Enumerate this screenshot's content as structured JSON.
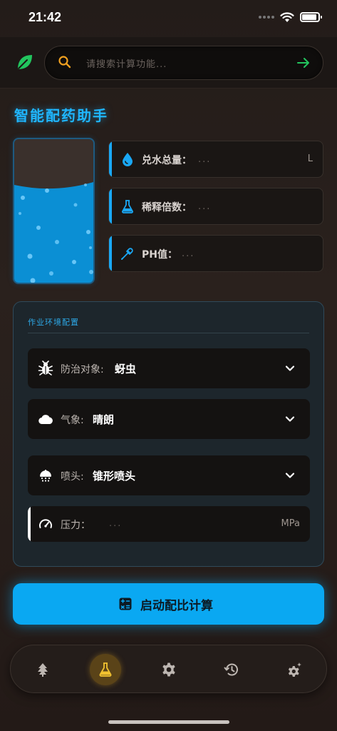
{
  "status_bar": {
    "time": "21:42"
  },
  "search": {
    "placeholder": "请搜索计算功能..."
  },
  "page": {
    "title": "智能配药助手"
  },
  "beaker": {
    "fill_fraction": 0.68
  },
  "info_cards": [
    {
      "label": "兑水总量：",
      "value": "...",
      "unit": "L",
      "icon": "water-drop-icon"
    },
    {
      "label": "稀释倍数：",
      "value": "...",
      "icon": "flask-icon"
    },
    {
      "label": "PH值：",
      "value": "...",
      "icon": "dropper-icon"
    }
  ],
  "env": {
    "title": "作业环境配置",
    "target": {
      "label": "防治对象:",
      "value": "蚜虫",
      "icon": "bug-icon"
    },
    "weather": {
      "label": "气象:",
      "value": "晴朗",
      "icon": "cloud-icon"
    },
    "nozzle": {
      "label": "喷头:",
      "value": "锥形喷头",
      "icon": "shower-icon"
    },
    "pressure": {
      "label": "压力：",
      "value": "...",
      "unit": "MPa",
      "icon": "gauge-icon"
    }
  },
  "start_button": {
    "label": "启动配比计算",
    "icon": "calculator-icon"
  },
  "tabs": [
    {
      "name": "tree-icon",
      "active": false
    },
    {
      "name": "flask-icon",
      "active": true
    },
    {
      "name": "gear-icon",
      "active": false
    },
    {
      "name": "history-icon",
      "active": false
    },
    {
      "name": "gear-sparkle-icon",
      "active": false
    }
  ],
  "colors": {
    "accent": "#0aa8f2",
    "title": "#1fb6ff",
    "leaf": "#22c55e",
    "search_icon": "#f0a020",
    "go_arrow": "#22c55e",
    "tab_active": "#f2c230",
    "tab_idle": "#bdb6b1"
  }
}
